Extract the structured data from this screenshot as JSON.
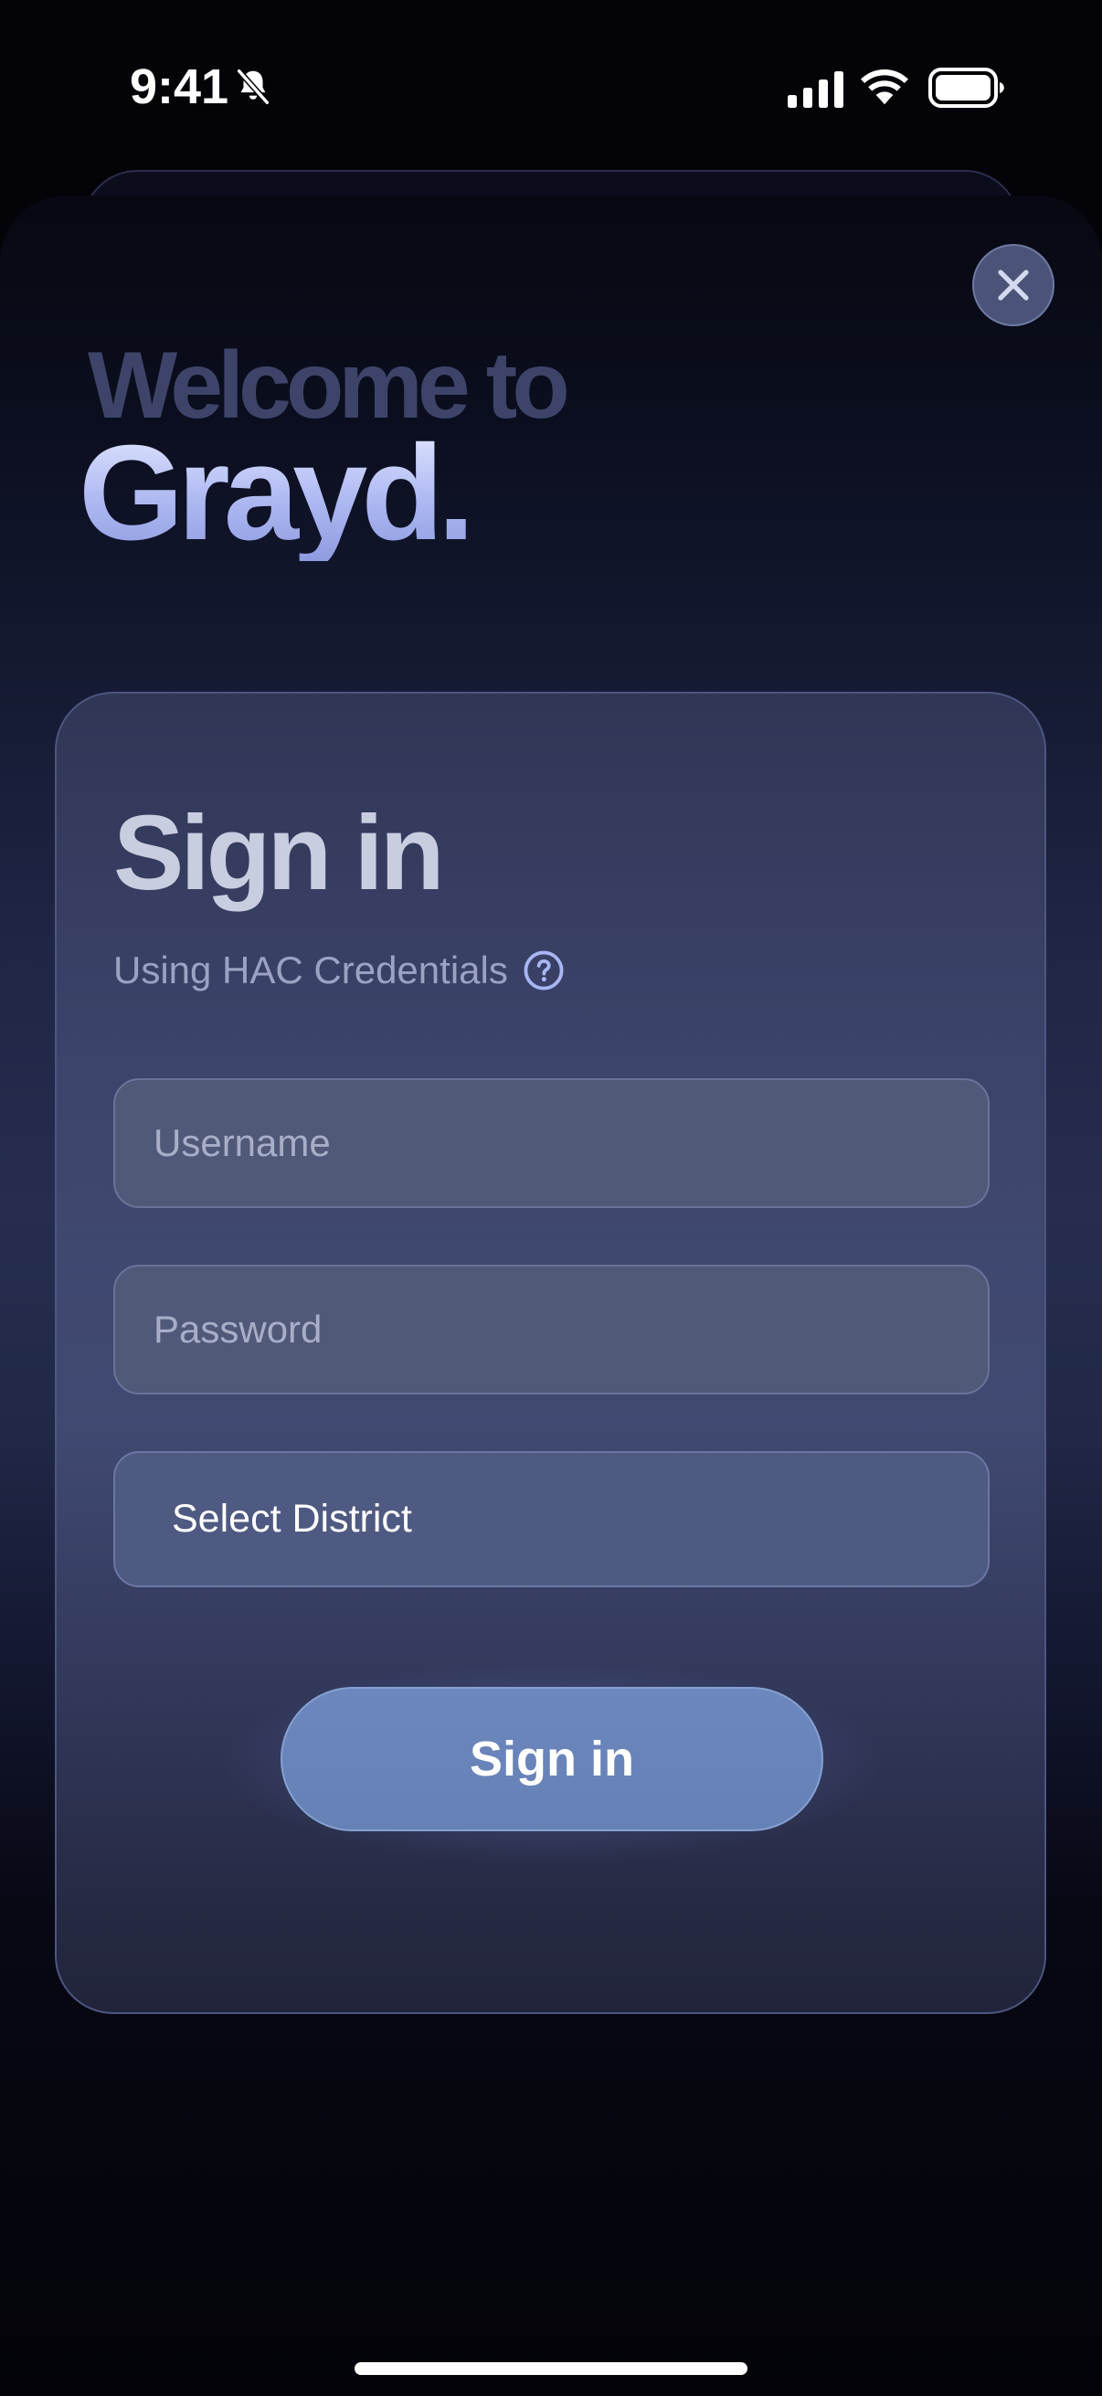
{
  "status_bar": {
    "time": "9:41",
    "icons": [
      "bell-slash-icon",
      "cellular-signal-icon",
      "wifi-icon",
      "battery-icon"
    ]
  },
  "header": {
    "welcome": "Welcome to",
    "brand": "Grayd."
  },
  "signin": {
    "title": "Sign in",
    "subtitle": "Using HAC Credentials",
    "help_icon": "question-circle-icon",
    "username_placeholder": "Username",
    "password_placeholder": "Password",
    "district_label": "Select District",
    "submit_label": "Sign in"
  },
  "colors": {
    "background": "#030308",
    "card": "#444c74",
    "field": "#515978",
    "button": "#6a85bb",
    "brand_text": "#b7c1f3",
    "welcome_text": "#3e4469"
  }
}
